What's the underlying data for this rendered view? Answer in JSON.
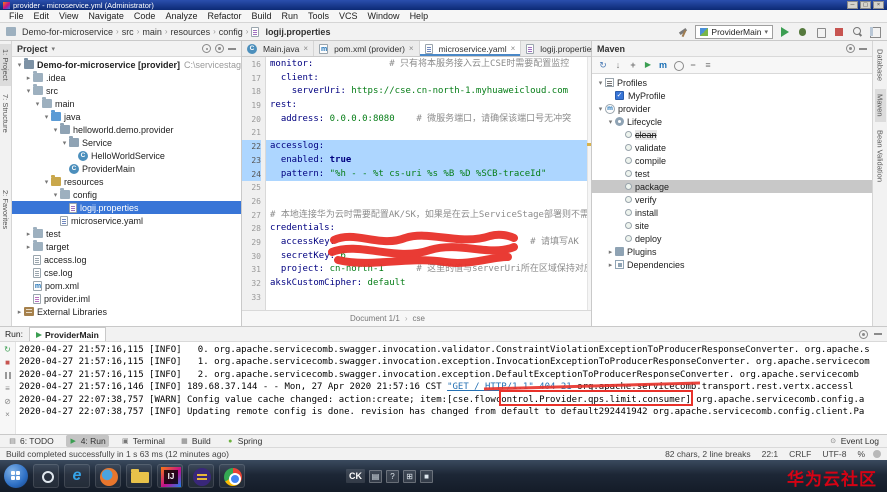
{
  "title_bar": {
    "title": "provider - microservice.yml (Administrator)"
  },
  "menu_bar": {
    "items": [
      "File",
      "Edit",
      "View",
      "Navigate",
      "Code",
      "Analyze",
      "Refactor",
      "Build",
      "Run",
      "Tools",
      "VCS",
      "Window",
      "Help"
    ]
  },
  "nav_bar": {
    "breadcrumbs": [
      "Demo-for-microservice",
      "src",
      "main",
      "resources",
      "config",
      "logij.properties"
    ],
    "run_config": "ProviderMain"
  },
  "tool_strips": {
    "left": [
      "1: Project",
      "7: Structure",
      "2: Favorites"
    ],
    "right": [
      "Database",
      "Maven",
      "Bean Validation"
    ]
  },
  "project_panel": {
    "title": "Project",
    "items": [
      {
        "depth": 0,
        "arrow": "v",
        "icon": "project",
        "label": "Demo-for-microservice [provider]",
        "suffix": "C:\\servicestage",
        "bold": true
      },
      {
        "depth": 1,
        "arrow": ">",
        "icon": "folder",
        "label": ".idea"
      },
      {
        "depth": 1,
        "arrow": "v",
        "icon": "folder",
        "label": "src"
      },
      {
        "depth": 2,
        "arrow": "v",
        "icon": "folder",
        "label": "main"
      },
      {
        "depth": 3,
        "arrow": "v",
        "icon": "srcroot",
        "label": "java"
      },
      {
        "depth": 4,
        "arrow": "v",
        "icon": "package",
        "label": "helloworld.demo.provider"
      },
      {
        "depth": 5,
        "arrow": "v",
        "icon": "package",
        "label": "Service"
      },
      {
        "depth": 6,
        "icon": "class",
        "label": "HelloWorldService"
      },
      {
        "depth": 5,
        "icon": "class",
        "label": "ProviderMain"
      },
      {
        "depth": 3,
        "arrow": "v",
        "icon": "resroot",
        "label": "resources"
      },
      {
        "depth": 4,
        "arrow": "v",
        "icon": "folder",
        "label": "config"
      },
      {
        "depth": 5,
        "icon": "props",
        "label": "logij.properties",
        "selected": true
      },
      {
        "depth": 4,
        "icon": "yaml",
        "label": "microservice.yaml"
      },
      {
        "depth": 1,
        "arrow": ">",
        "icon": "folder",
        "label": "test"
      },
      {
        "depth": 1,
        "arrow": ">",
        "icon": "folder",
        "label": "target"
      },
      {
        "depth": 1,
        "icon": "text",
        "label": "access.log"
      },
      {
        "depth": 1,
        "icon": "text",
        "label": "cse.log"
      },
      {
        "depth": 1,
        "icon": "maven",
        "label": "pom.xml"
      },
      {
        "depth": 1,
        "icon": "iml",
        "label": "provider.iml"
      },
      {
        "depth": 0,
        "arrow": ">",
        "icon": "lib",
        "label": "External Libraries"
      }
    ]
  },
  "editor": {
    "tabs": [
      {
        "label": "Main.java",
        "icon": "class",
        "active": false
      },
      {
        "label": "pom.xml (provider)",
        "icon": "maven",
        "active": false
      },
      {
        "label": "microservice.yaml",
        "icon": "yaml",
        "active": true
      },
      {
        "label": "logij.properties",
        "icon": "props",
        "active": false
      }
    ],
    "footer": {
      "document": "Document 1/1",
      "crumb": "cse"
    },
    "lines": [
      {
        "n": 16,
        "segs": [
          {
            "t": "monitor:",
            "c": "key"
          },
          {
            "t": "              ",
            "c": "p"
          },
          {
            "t": "# 只有将本服务接入云上CSE时需要配置监控",
            "c": "cmt"
          }
        ]
      },
      {
        "n": 17,
        "segs": [
          {
            "t": "  ",
            "c": "p"
          },
          {
            "t": "client:",
            "c": "key"
          }
        ]
      },
      {
        "n": 18,
        "segs": [
          {
            "t": "    ",
            "c": "p"
          },
          {
            "t": "serverUri:",
            "c": "key"
          },
          {
            "t": " ",
            "c": "p"
          },
          {
            "t": "https://cse.cn-north-1.myhuaweicloud.com",
            "c": "val"
          }
        ]
      },
      {
        "n": 19,
        "segs": [
          {
            "t": "rest:",
            "c": "key"
          }
        ]
      },
      {
        "n": 20,
        "segs": [
          {
            "t": "  ",
            "c": "p"
          },
          {
            "t": "address:",
            "c": "key"
          },
          {
            "t": " ",
            "c": "p"
          },
          {
            "t": "0.0.0.0:8080",
            "c": "val"
          },
          {
            "t": "    ",
            "c": "p"
          },
          {
            "t": "# 微服务端口，请确保该端口号无冲突",
            "c": "cmt"
          }
        ]
      },
      {
        "n": 21,
        "segs": []
      },
      {
        "n": 22,
        "sel": true,
        "segs": [
          {
            "t": "accesslog:",
            "c": "key"
          }
        ]
      },
      {
        "n": 23,
        "sel": true,
        "segs": [
          {
            "t": "  ",
            "c": "p"
          },
          {
            "t": "enabled:",
            "c": "key"
          },
          {
            "t": " ",
            "c": "p"
          },
          {
            "t": "true",
            "c": "kw"
          }
        ]
      },
      {
        "n": 24,
        "sel": true,
        "segs": [
          {
            "t": "  ",
            "c": "p"
          },
          {
            "t": "pattern:",
            "c": "key"
          },
          {
            "t": " ",
            "c": "p"
          },
          {
            "t": "\"%h - - %t cs-uri %s %B %D %SCB-traceId\"",
            "c": "val"
          }
        ]
      },
      {
        "n": 25,
        "segs": []
      },
      {
        "n": 26,
        "segs": []
      },
      {
        "n": 27,
        "segs": [
          {
            "t": "# 本地连接华为云时需要配置AK/SK，如果是在云上ServiceStage部署则不需要",
            "c": "cmt"
          }
        ]
      },
      {
        "n": 28,
        "segs": [
          {
            "t": "credentials:",
            "c": "key"
          }
        ]
      },
      {
        "n": 29,
        "segs": [
          {
            "t": "  ",
            "c": "p"
          },
          {
            "t": "accessKey:",
            "c": "key"
          },
          {
            "t": "                                    ",
            "c": "p"
          },
          {
            "t": "# 请填写AK",
            "c": "cmt"
          }
        ]
      },
      {
        "n": 30,
        "segs": [
          {
            "t": "  ",
            "c": "p"
          },
          {
            "t": "secretKey:",
            "c": "key"
          },
          {
            "t": " 6",
            "c": "val"
          }
        ]
      },
      {
        "n": 31,
        "segs": [
          {
            "t": "  ",
            "c": "p"
          },
          {
            "t": "project:",
            "c": "key"
          },
          {
            "t": " ",
            "c": "p"
          },
          {
            "t": "cn-north-1",
            "c": "val"
          },
          {
            "t": "      ",
            "c": "p"
          },
          {
            "t": "# 这里的值与serverUri所在区域保持对应",
            "c": "cmt"
          }
        ]
      },
      {
        "n": 32,
        "segs": [
          {
            "t": "akskCustomCipher:",
            "c": "key"
          },
          {
            "t": " ",
            "c": "p"
          },
          {
            "t": "default",
            "c": "val"
          }
        ]
      },
      {
        "n": 33,
        "segs": []
      }
    ]
  },
  "maven_panel": {
    "title": "Maven",
    "toolbar": [
      "refresh",
      "download",
      "add",
      "run",
      "goal",
      "gear",
      "collapse",
      "filter"
    ],
    "items": [
      {
        "depth": 0,
        "arrow": "v",
        "icon": "profiles",
        "label": "Profiles"
      },
      {
        "depth": 1,
        "check": true,
        "label": "MyProfile"
      },
      {
        "depth": 0,
        "arrow": "v",
        "icon": "mvnprj",
        "label": "provider"
      },
      {
        "depth": 1,
        "arrow": "v",
        "icon": "lifecycle",
        "label": "Lifecycle"
      },
      {
        "depth": 2,
        "icon": "goal",
        "label": "clean",
        "strike": true
      },
      {
        "depth": 2,
        "icon": "goal",
        "label": "validate"
      },
      {
        "depth": 2,
        "icon": "goal",
        "label": "compile"
      },
      {
        "depth": 2,
        "icon": "goal",
        "label": "test"
      },
      {
        "depth": 2,
        "icon": "goal",
        "label": "package",
        "selected": true
      },
      {
        "depth": 2,
        "icon": "goal",
        "label": "verify"
      },
      {
        "depth": 2,
        "icon": "goal",
        "label": "install"
      },
      {
        "depth": 2,
        "icon": "goal",
        "label": "site"
      },
      {
        "depth": 2,
        "icon": "goal",
        "label": "deploy"
      },
      {
        "depth": 1,
        "arrow": ">",
        "icon": "plugins",
        "label": "Plugins"
      },
      {
        "depth": 1,
        "arrow": ">",
        "icon": "deps",
        "label": "Dependencies"
      }
    ]
  },
  "run_panel": {
    "label": "Run:",
    "tab": "ProviderMain",
    "tools": [
      "rerun",
      "stop",
      "pause",
      "restore",
      "skip",
      "clear"
    ],
    "log": [
      {
        "segs": [
          {
            "t": "2020-04-27 21:57:16,115 [INFO]   0. org.apache.servicecomb.swagger.invocation.validator.ConstraintViolationExceptionToProducerResponseConverter. org.apache.s",
            "c": "p"
          }
        ]
      },
      {
        "segs": [
          {
            "t": "2020-04-27 21:57:16,115 [INFO]   1. org.apache.servicecomb.swagger.invocation.exception.InvocationExceptionToProducerResponseConverter. org.apache.servicecom",
            "c": "p"
          }
        ]
      },
      {
        "segs": [
          {
            "t": "2020-04-27 21:57:16,115 [INFO]   2. org.apache.servicecomb.swagger.invocation.exception.DefaultExceptionToProducerResponseConverter. org.apache.servicecomb",
            "c": "p"
          }
        ]
      },
      {
        "segs": [
          {
            "t": "2020-04-27 21:57:16,146 [INFO] 189.68.37.144 - - Mon, 27 Apr 2020 21:57:16 CST ",
            "c": "p"
          },
          {
            "t": "\"GET / HTTP/1.1\" 404 21",
            "c": "link"
          },
          {
            "t": " org.apache.servicecomb.transport.rest.vertx.accessl",
            "c": "p"
          }
        ]
      },
      {
        "segs": [
          {
            "t": "2020-04-27 22:07:38,757 [WARN] Config value cache changed: action:create; item:[cse.flowcontrol.Provider.qps.limit.consumer] org.apache.servicecomb.config.a",
            "c": "p"
          }
        ]
      },
      {
        "segs": [
          {
            "t": "2020-04-27 22:07:38,757 [INFO] Updating remote config is done. revision has changed from default to default292441942 org.apache.servicecomb.config.client.Pa",
            "c": "p"
          }
        ]
      }
    ]
  },
  "status_bar": {
    "tool_buttons_left": [
      {
        "label": "6: TODO",
        "icon": "todo",
        "active": false
      },
      {
        "label": "4: Run",
        "icon": "run",
        "active": true
      },
      {
        "label": "Terminal",
        "icon": "terminal",
        "active": false
      },
      {
        "label": "Build",
        "icon": "build",
        "active": false
      },
      {
        "label": "Spring",
        "icon": "spring",
        "active": false
      }
    ],
    "tool_buttons_right": [
      {
        "label": "Event Log",
        "icon": "eventlog",
        "active": false
      }
    ],
    "message": "Build completed successfully in 1 s 63 ms (12 minutes ago)",
    "right_items": [
      "82 chars, 2 line breaks",
      "22:1",
      "CRLF",
      "UTF-8",
      "%"
    ]
  },
  "taskbar": {
    "apps": [
      "search",
      "ie",
      "firefox",
      "folder",
      "intellij",
      "eclipse",
      "chrome"
    ],
    "tray": {
      "language": "CK",
      "icons": [
        "keyboard",
        "help",
        "grid",
        "screen"
      ]
    },
    "watermark": "华为云社区"
  },
  "annotations": {
    "editor_redaction": "red marker scribble hiding accessKey / secretKey values",
    "log_strike": "red marker line through request log entry",
    "log_box": "red box around cse.flowcontrol.Provider.qps.limit.consumer"
  }
}
